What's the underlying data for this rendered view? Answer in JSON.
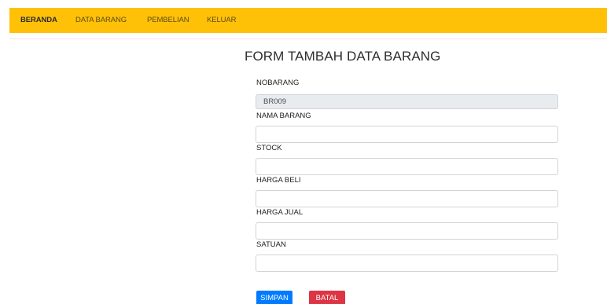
{
  "nav": {
    "items": [
      {
        "label": "BERANDA",
        "active": true
      },
      {
        "label": "DATA BARANG",
        "active": false
      },
      {
        "label": "PEMBELIAN",
        "active": false
      },
      {
        "label": "KELUAR",
        "active": false
      }
    ]
  },
  "form": {
    "title": "FORM TAMBAH DATA BARANG",
    "fields": [
      {
        "label": "NOBARANG",
        "value": "BR009",
        "readonly": true
      },
      {
        "label": "NAMA BARANG",
        "value": ""
      },
      {
        "label": "STOCK",
        "value": ""
      },
      {
        "label": "HARGA BELI",
        "value": ""
      },
      {
        "label": "HARGA JUAL",
        "value": ""
      },
      {
        "label": "SATUAN",
        "value": ""
      }
    ],
    "buttons": {
      "save": "SIMPAN",
      "cancel": "BATAL"
    }
  },
  "colors": {
    "navbar": "#ffc107",
    "primary": "#007bff",
    "danger": "#dc3545",
    "readonly_bg": "#e9ecef"
  }
}
